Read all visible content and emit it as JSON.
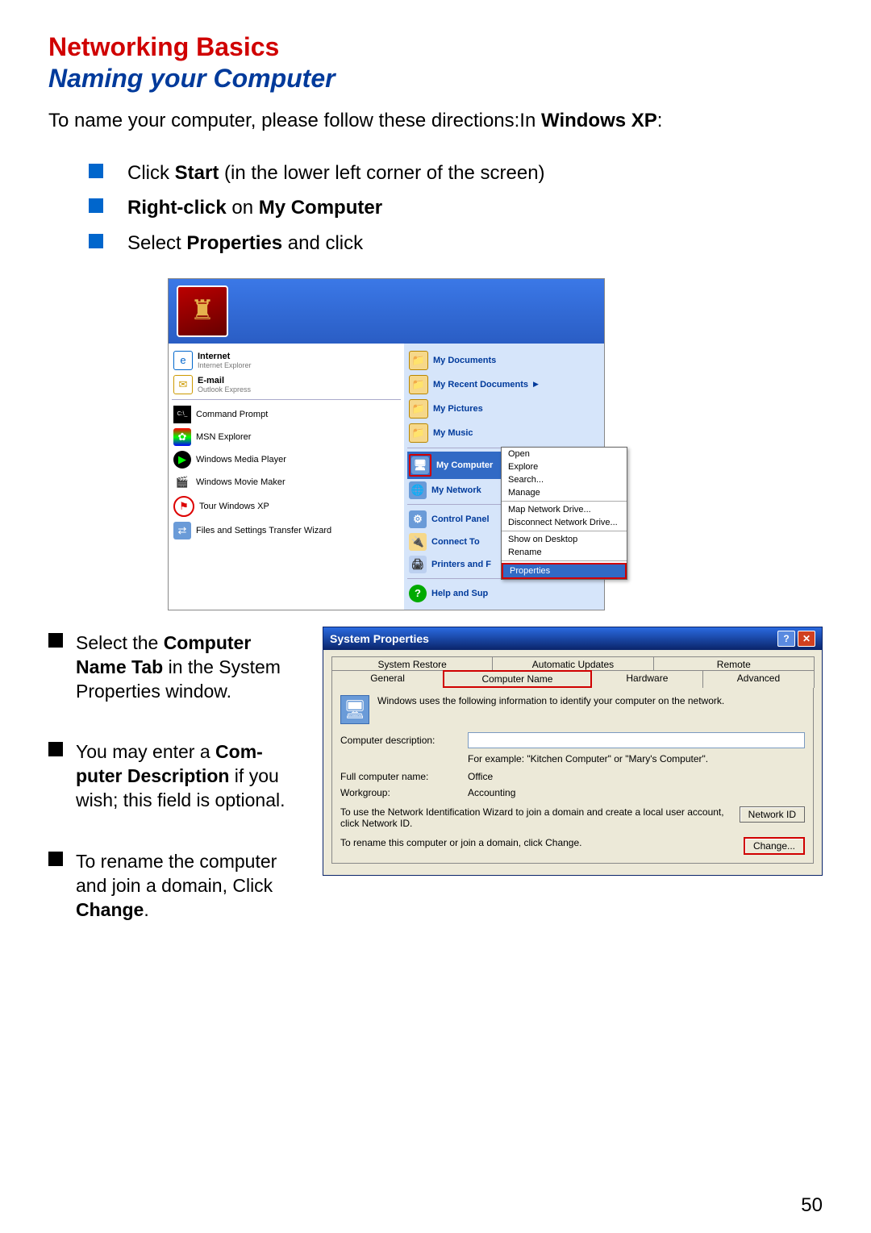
{
  "heading": "Networking Basics",
  "subheading": "Naming your Computer",
  "intro_pre": "To name your computer, please follow these directions:In ",
  "intro_bold": "Windows XP",
  "intro_post": ":",
  "bullets": {
    "b1_pre": "Click ",
    "b1_bold": "Start",
    "b1_post": " (in the lower left corner of the screen)",
    "b2_bold1": "Right-click",
    "b2_mid": " on ",
    "b2_bold2": "My Computer",
    "b3_pre": "Select ",
    "b3_bold": "Properties",
    "b3_post": " and click"
  },
  "startmenu": {
    "left": {
      "internet": "Internet",
      "internet_sub": "Internet Explorer",
      "email": "E-mail",
      "email_sub": "Outlook Express",
      "cmd": "Command Prompt",
      "msn": "MSN Explorer",
      "wmp": "Windows Media Player",
      "wmm": "Windows Movie Maker",
      "tour": "Tour Windows XP",
      "fs": "Files and Settings Transfer Wizard"
    },
    "right": {
      "docs": "My Documents",
      "recent": "My Recent Documents",
      "pics": "My Pictures",
      "music": "My Music",
      "comp": "My Computer",
      "net": "My Network",
      "cp": "Control Panel",
      "con": "Connect To",
      "pri": "Printers and F",
      "help": "Help and Sup"
    },
    "ctx": [
      "Open",
      "Explore",
      "Search...",
      "Manage",
      "Map Network Drive...",
      "Disconnect Network Drive...",
      "Show on Desktop",
      "Rename",
      "Properties"
    ]
  },
  "notes": {
    "n1_pre": "Select the ",
    "n1_bold": "Computer Name Tab",
    "n1_post": " in the System Properties window.",
    "n2_pre": "You may enter a ",
    "n2_bold": "Com­puter Description",
    "n2_post": " if you wish; this field is optional.",
    "n3_pre": "To rename the computer and join a domain, Click ",
    "n3_bold": "Change",
    "n3_post": "."
  },
  "sys": {
    "title": "System Properties",
    "tabs_row1": [
      "System Restore",
      "Automatic Updates",
      "Remote"
    ],
    "tabs_row2": [
      "General",
      "Computer Name",
      "Hardware",
      "Advanced"
    ],
    "desc": "Windows uses the following information to identify your computer on the network.",
    "field_desc_label": "Computer description:",
    "hint": "For example: \"Kitchen Computer\" or \"Mary's Computer\".",
    "fullname_label": "Full computer name:",
    "fullname_val": "Office",
    "workgroup_label": "Workgroup:",
    "workgroup_val": "Accounting",
    "netid_txt": "To use the Network Identification Wizard to join a domain and create a local user account, click Network ID.",
    "netid_btn": "Network ID",
    "change_txt": "To rename this computer or join a domain, click Change.",
    "change_btn": "Change..."
  },
  "page_number": "50"
}
